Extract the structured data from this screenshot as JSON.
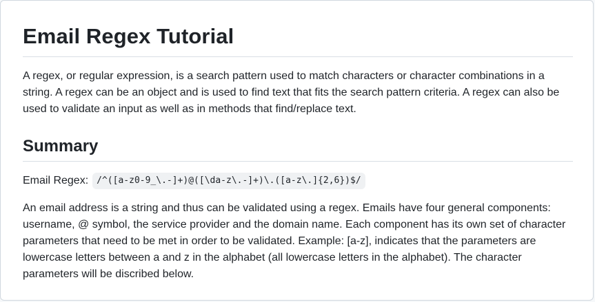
{
  "title": "Email Regex Tutorial",
  "intro": "A regex, or regular expression, is a search pattern used to match characters or character combinations in a string. A regex can be an object and is used to find text that fits the search pattern criteria. A regex can also be used to validate an input as well as in methods that find/replace text.",
  "summary": {
    "heading": "Summary",
    "regex_label": "Email Regex:",
    "regex_code": "/^([a-z0-9_\\.-]+)@([\\da-z\\.-]+)\\.([a-z\\.]{2,6})$/",
    "description": "An email address is a string and thus can be validated using a regex. Emails have four general components: username, @ symbol, the service provider and the domain name. Each component has its own set of character parameters that need to be met in order to be validated. Example: [a-z], indicates that the parameters are lowercase letters between a and z in the alphabet (all lowercase letters in the alphabet). The character parameters will be discribed below."
  }
}
